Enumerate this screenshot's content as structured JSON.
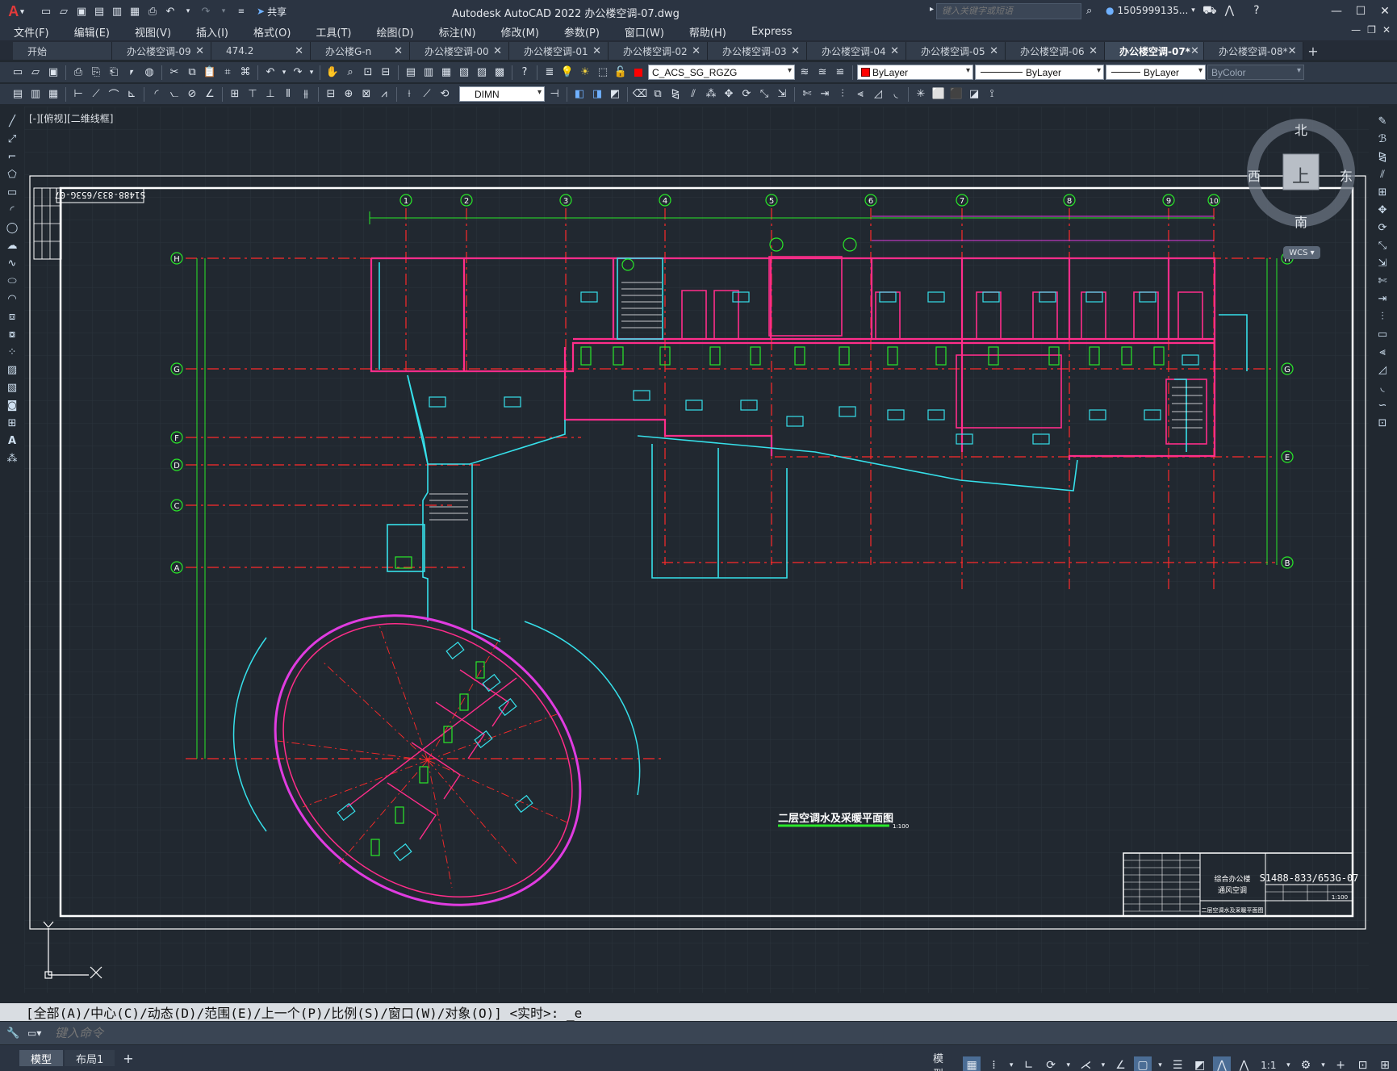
{
  "app": {
    "logo": "A",
    "title": "Autodesk AutoCAD 2022    办公楼空调-07.dwg",
    "share_label": "共享",
    "search_placeholder": "键入关键字或短语",
    "user": "1505999135...",
    "window_controls": [
      "—",
      "☐",
      "✕"
    ],
    "doc_controls": [
      "—",
      "❐",
      "✕"
    ]
  },
  "menu": [
    "文件(F)",
    "编辑(E)",
    "视图(V)",
    "插入(I)",
    "格式(O)",
    "工具(T)",
    "绘图(D)",
    "标注(N)",
    "修改(M)",
    "参数(P)",
    "窗口(W)",
    "帮助(H)",
    "Express"
  ],
  "tabs": [
    {
      "label": "开始",
      "active": false,
      "closable": false
    },
    {
      "label": "办公楼空调-09",
      "active": false,
      "closable": true
    },
    {
      "label": "474.2",
      "active": false,
      "closable": true
    },
    {
      "label": "办公楼G-n",
      "active": false,
      "closable": true
    },
    {
      "label": "办公楼空调-00",
      "active": false,
      "closable": true
    },
    {
      "label": "办公楼空调-01",
      "active": false,
      "closable": true
    },
    {
      "label": "办公楼空调-02",
      "active": false,
      "closable": true
    },
    {
      "label": "办公楼空调-03",
      "active": false,
      "closable": true
    },
    {
      "label": "办公楼空调-04",
      "active": false,
      "closable": true
    },
    {
      "label": "办公楼空调-05",
      "active": false,
      "closable": true
    },
    {
      "label": "办公楼空调-06",
      "active": false,
      "closable": true
    },
    {
      "label": "办公楼空调-07*",
      "active": true,
      "closable": true
    },
    {
      "label": "办公楼空调-08*",
      "active": false,
      "closable": true
    }
  ],
  "layers": {
    "current_layer": "C_ACS_SG_RGZG",
    "color": "ByLayer",
    "linetype": "ByLayer",
    "lineweight": "ByLayer",
    "plotstyle": "ByColor",
    "dimstyle": "DIMN"
  },
  "viewport": {
    "label": "[-][俯视][二维线框]",
    "viewcube": {
      "north": "北",
      "south": "南",
      "east": "东",
      "west": "西",
      "face": "上",
      "wcs": "WCS ▾"
    }
  },
  "drawing": {
    "plan_title": "二层空调水及采暖平面图",
    "plan_scale": "1:100",
    "drawing_number": "S1488-833/653G-07",
    "stamp_number": "S1488-833/653G-07",
    "grid_columns": [
      "1",
      "2",
      "3",
      "4",
      "5",
      "6",
      "7",
      "8",
      "9",
      "10"
    ],
    "grid_rows_left": [
      "H",
      "G",
      "F",
      "D",
      "C",
      "A"
    ],
    "grid_rows_right": [
      "H",
      "G",
      "E",
      "B"
    ],
    "titleblock": {
      "project": "综合办公楼",
      "discipline": "通风空调",
      "sheet_title": "二层空调水及采暖平面图",
      "scale_value": "1:100"
    },
    "colors": {
      "wall": "#ff2d8a",
      "duct": "#36e0ea",
      "equipment": "#29e829",
      "axis": "#ff2a2a",
      "frame": "#ffffff",
      "magenta": "#e03ce0"
    }
  },
  "command": {
    "history": "[全部(A)/中心(C)/动态(D)/范围(E)/上一个(P)/比例(S)/窗口(W)/对象(O)] <实时>: _e",
    "placeholder": "键入命令"
  },
  "status": {
    "layout_tabs": [
      {
        "label": "模型",
        "active": true
      },
      {
        "label": "布局1",
        "active": false
      }
    ],
    "model_label": "模型",
    "scale": "1:1"
  }
}
